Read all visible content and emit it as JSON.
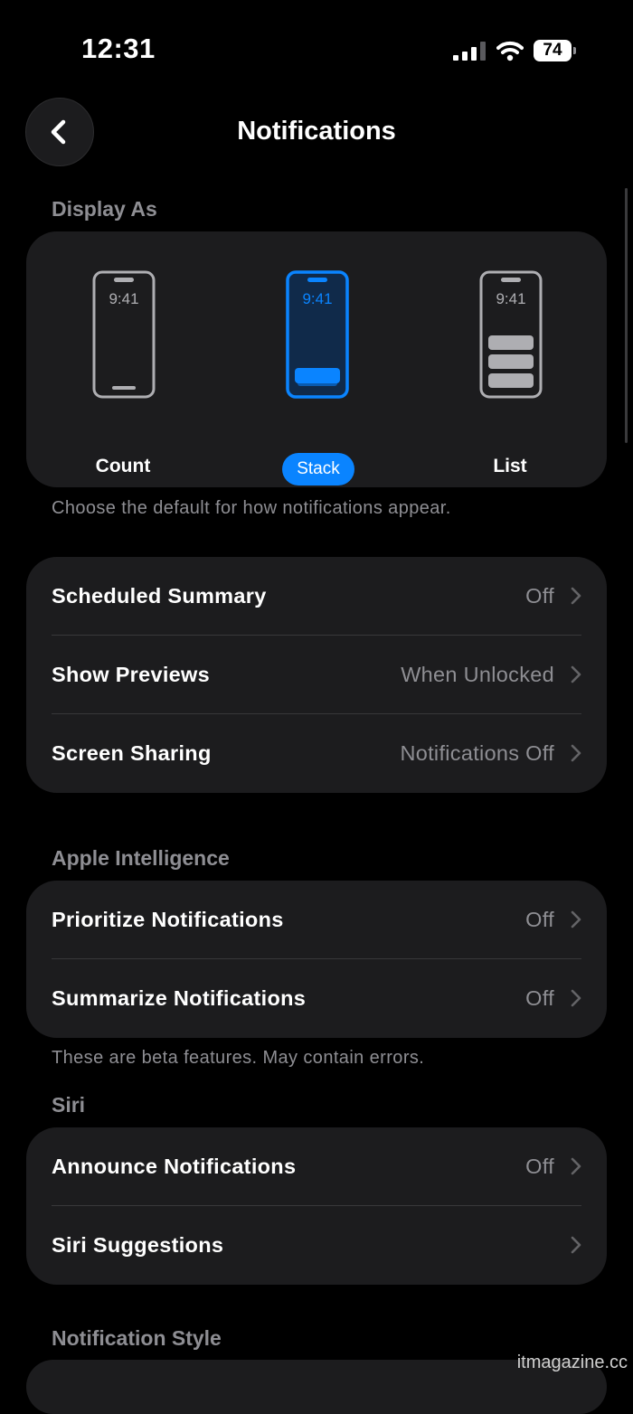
{
  "status_bar": {
    "time": "12:31",
    "battery": "74"
  },
  "nav": {
    "title": "Notifications",
    "back_icon": "chevron-left-icon"
  },
  "display_as": {
    "header": "Display As",
    "options": [
      {
        "label": "Count",
        "phone_time": "9:41",
        "selected": false
      },
      {
        "label": "Stack",
        "phone_time": "9:41",
        "selected": true
      },
      {
        "label": "List",
        "phone_time": "9:41",
        "selected": false
      }
    ],
    "footer": "Choose the default for how notifications appear."
  },
  "general": {
    "rows": [
      {
        "label": "Scheduled Summary",
        "value": "Off"
      },
      {
        "label": "Show Previews",
        "value": "When Unlocked"
      },
      {
        "label": "Screen Sharing",
        "value": "Notifications Off"
      }
    ]
  },
  "apple_intelligence": {
    "header": "Apple Intelligence",
    "rows": [
      {
        "label": "Prioritize Notifications",
        "value": "Off"
      },
      {
        "label": "Summarize Notifications",
        "value": "Off"
      }
    ],
    "footer": "These are beta features. May contain errors."
  },
  "siri": {
    "header": "Siri",
    "rows": [
      {
        "label": "Announce Notifications",
        "value": "Off"
      },
      {
        "label": "Siri Suggestions",
        "value": ""
      }
    ]
  },
  "notification_style": {
    "header": "Notification Style"
  },
  "watermark": "itmagazine.cc",
  "colors": {
    "accent": "#0a84ff",
    "card": "#1c1c1e",
    "secondary_text": "#8e8e93",
    "background": "#000000"
  }
}
